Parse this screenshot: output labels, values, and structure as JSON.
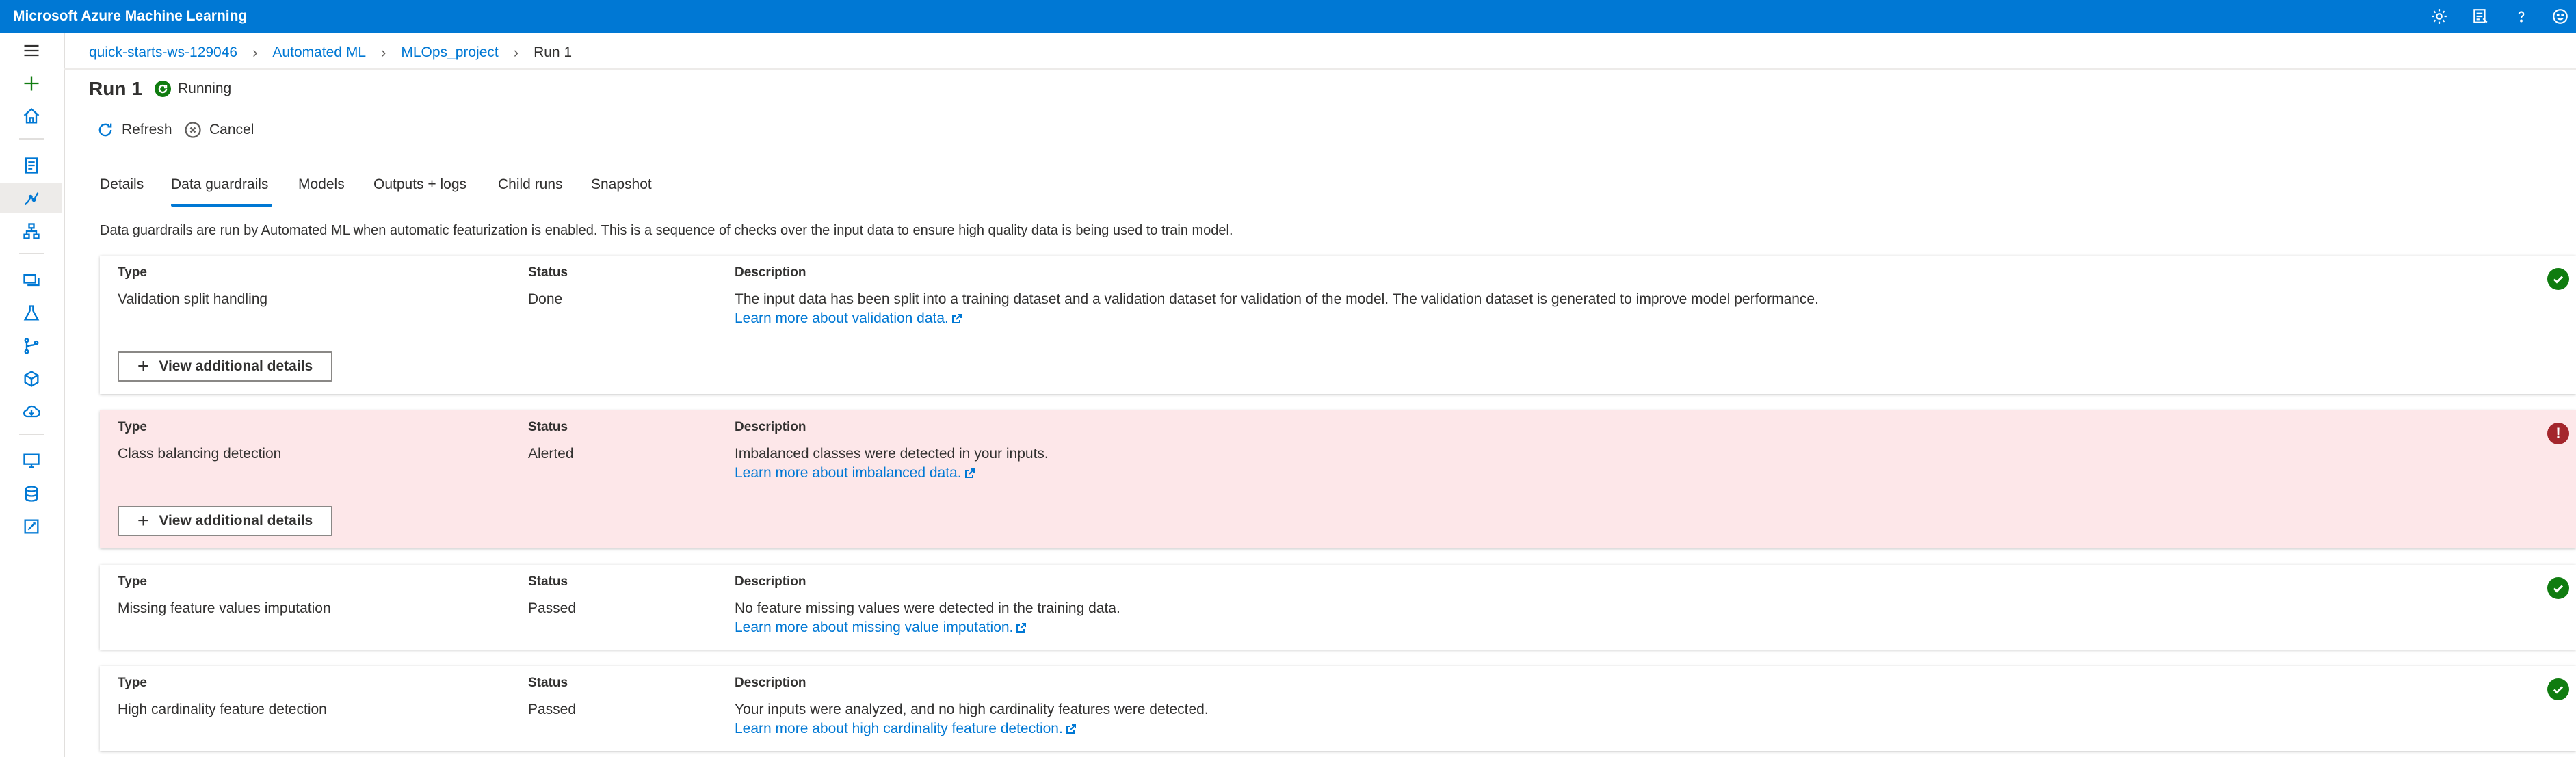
{
  "app": {
    "title": "Microsoft Azure Machine Learning"
  },
  "topbar_icons": [
    "gear-icon",
    "feedback-icon",
    "help-icon",
    "smiley-icon"
  ],
  "left_rail": {
    "icons": [
      "hamburger-icon",
      "add-icon",
      "home-icon",
      "notebook-icon",
      "automated-ml-icon",
      "designer-icon",
      "datasets-icon",
      "experiments-icon",
      "pipelines-icon",
      "models-icon",
      "endpoints-icon",
      "compute-icon",
      "datastores-icon",
      "data-labeling-icon"
    ],
    "selected": "automated-ml-icon"
  },
  "breadcrumb": {
    "items": [
      "quick-starts-ws-129046",
      "Automated ML",
      "MLOps_project"
    ],
    "current": "Run 1"
  },
  "run": {
    "title": "Run 1",
    "status": "Running"
  },
  "commands": {
    "refresh": "Refresh",
    "cancel": "Cancel"
  },
  "tabs": [
    "Details",
    "Data guardrails",
    "Models",
    "Outputs + logs",
    "Child runs",
    "Snapshot"
  ],
  "active_tab": "Data guardrails",
  "intro": "Data guardrails are run by Automated ML when automatic featurization is enabled. This is a sequence of checks over the input data to ensure high quality data is being used to train model.",
  "headers": {
    "type": "Type",
    "status": "Status",
    "description": "Description"
  },
  "details_button_label": "View additional details",
  "guardrails": [
    {
      "type": "Validation split handling",
      "status": "Done",
      "description": "The input data has been split into a training dataset and a validation dataset for validation of the model. The validation dataset is generated to improve model performance.",
      "link": "Learn more about validation data."
    },
    {
      "type": "Class balancing detection",
      "status": "Alerted",
      "description": "Imbalanced classes were detected in your inputs.",
      "link": "Learn more about imbalanced data."
    },
    {
      "type": "Missing feature values imputation",
      "status": "Passed",
      "description": "No feature missing values were detected in the training data.",
      "link": "Learn more about missing value imputation."
    },
    {
      "type": "High cardinality feature detection",
      "status": "Passed",
      "description": "Your inputs were analyzed, and no high cardinality features were detected.",
      "link": "Learn more about high cardinality feature detection."
    }
  ],
  "colors": {
    "accent": "#0078d4",
    "success": "#107c10",
    "alert": "#a4262c",
    "alert_bg": "#fde7e9"
  }
}
